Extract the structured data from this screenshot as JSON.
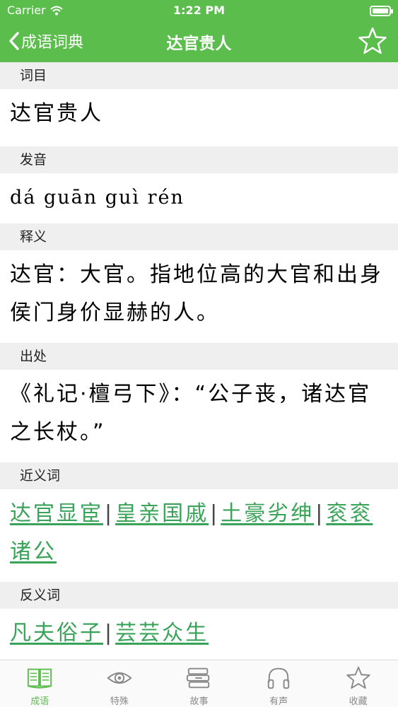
{
  "status": {
    "carrier": "Carrier",
    "time": "1:22 PM"
  },
  "nav": {
    "back_label": "成语词典",
    "title": "达官贵人"
  },
  "colors": {
    "accent": "#5bbd4b",
    "link": "#3aa35a",
    "section_bg": "#efefef"
  },
  "sections": {
    "entry": {
      "header": "词目",
      "text": "达官贵人"
    },
    "pronunciation": {
      "header": "发音",
      "text": "dá guān guì rén"
    },
    "definition": {
      "header": "释义",
      "text": "达官：大官。指地位高的大官和出身侯门身价显赫的人。"
    },
    "source": {
      "header": "出处",
      "text": "《礼记·檀弓下》：“公子丧，诸达官之长杖。”"
    },
    "synonyms": {
      "header": "近义词",
      "items": [
        "达官显宦",
        "皇亲国戚",
        "土豪劣绅",
        "衮衮诸公"
      ]
    },
    "antonyms": {
      "header": "反义词",
      "items": [
        "凡夫俗子",
        "芸芸众生"
      ]
    }
  },
  "tabs": [
    {
      "label": "成语",
      "icon": "book-icon",
      "active": true
    },
    {
      "label": "特殊",
      "icon": "eye-icon",
      "active": false
    },
    {
      "label": "故事",
      "icon": "books-stack-icon",
      "active": false
    },
    {
      "label": "有声",
      "icon": "headphones-icon",
      "active": false
    },
    {
      "label": "收藏",
      "icon": "star-icon",
      "active": false
    }
  ]
}
